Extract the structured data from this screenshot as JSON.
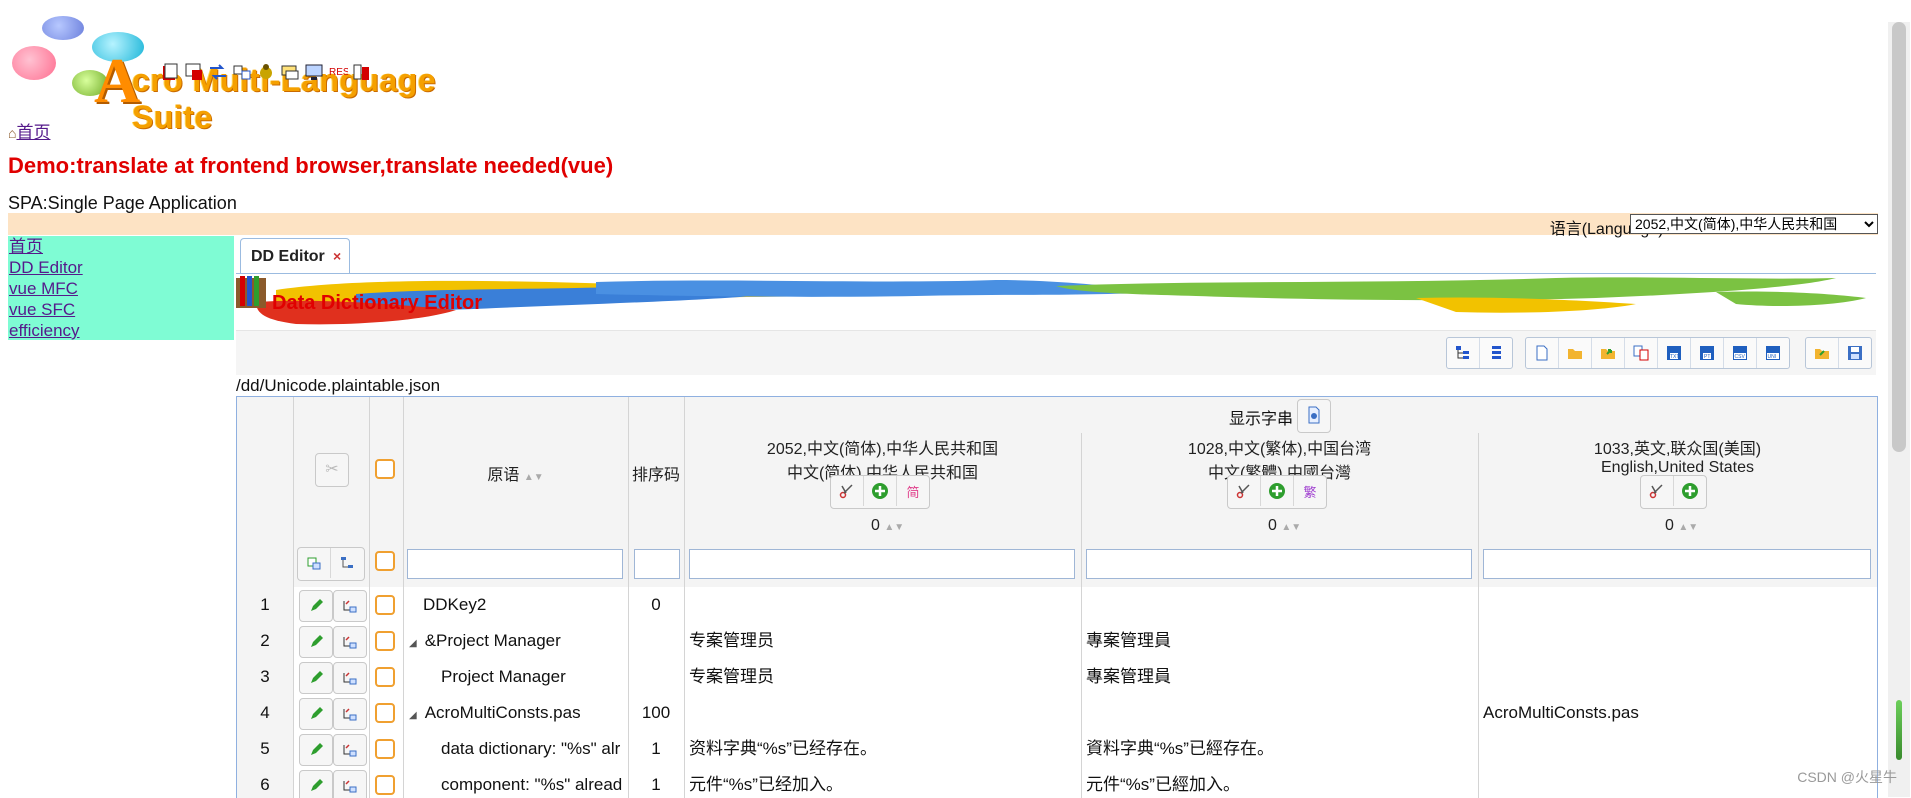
{
  "header": {
    "logo_big_letter": "A",
    "logo_text": "cro Multi-Language Suite",
    "home_link": "首页",
    "demo_title": "Demo:translate at frontend browser,translate needed(vue)",
    "spa_text": "SPA:Single Page Application",
    "language_label": "语言(Language):",
    "language_value": "2052,中文(简体),中华人民共和国"
  },
  "sidebar": {
    "items": [
      {
        "label": "首页"
      },
      {
        "label": "DD Editor"
      },
      {
        "label": "vue MFC"
      },
      {
        "label": "vue SFC"
      },
      {
        "label": "efficiency"
      }
    ]
  },
  "tab": {
    "label": "DD Editor",
    "close": "×"
  },
  "banner": {
    "title": "Data Dictionary Editor"
  },
  "file_path": "/dd/Unicode.plaintable.json",
  "grid": {
    "show_strings_label": "显示字串",
    "col_source": "原语",
    "col_sort_code": "排序码",
    "languages": [
      {
        "line1": "2052,中文(简体),中华人民共和国",
        "line2": "中文(简体),中华人民共和国",
        "count": "0",
        "extra_icon": "简"
      },
      {
        "line1": "1028,中文(繁体),中国台湾",
        "line2": "中文(繁體),中國台灣",
        "count": "0",
        "extra_icon": "繁"
      },
      {
        "line1": "1033,英文,联众国(美国)",
        "line2": "English,United States",
        "count": "0",
        "extra_icon": ""
      }
    ],
    "rows": [
      {
        "num": "1",
        "source": "DDKey2",
        "indent": 0,
        "tree": "",
        "sort": "0",
        "zh_cn": "",
        "zh_tw": "",
        "en": ""
      },
      {
        "num": "2",
        "source": "&Project Manager",
        "indent": 0,
        "tree": "◢",
        "sort": "",
        "zh_cn": "专案管理员",
        "zh_tw": "專案管理員",
        "en": ""
      },
      {
        "num": "3",
        "source": "Project Manager",
        "indent": 1,
        "tree": "",
        "sort": "",
        "zh_cn": "专案管理员",
        "zh_tw": "專案管理員",
        "en": ""
      },
      {
        "num": "4",
        "source": "AcroMultiConsts.pas",
        "indent": 0,
        "tree": "◢",
        "sort": "100",
        "zh_cn": "",
        "zh_tw": "",
        "en": "AcroMultiConsts.pas"
      },
      {
        "num": "5",
        "source": "data dictionary: \"%s\" alr",
        "indent": 1,
        "tree": "",
        "sort": "1",
        "zh_cn": "资料字典“%s”已经存在。",
        "zh_tw": "資料字典“%s”已經存在。",
        "en": ""
      },
      {
        "num": "6",
        "source": "component: \"%s\" alread",
        "indent": 1,
        "tree": "",
        "sort": "1",
        "zh_cn": "元件“%s”已经加入。",
        "zh_tw": "元件“%s”已經加入。",
        "en": ""
      }
    ]
  },
  "watermark": "CSDN @火星牛",
  "colors": {
    "accent_red": "#e00000",
    "sidebar_bg": "#7ffcd4",
    "lang_bar_bg": "#fde3c4",
    "checkbox_orange": "#f0a030",
    "edit_green": "#2e9e2e"
  }
}
